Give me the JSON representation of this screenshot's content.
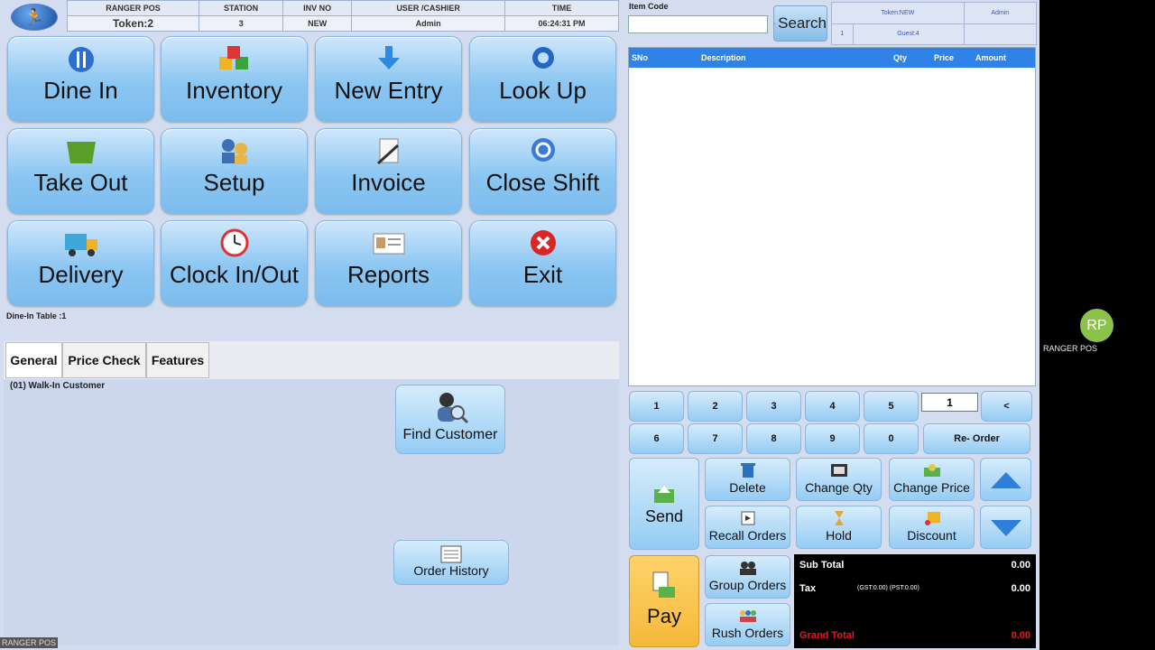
{
  "header": {
    "columns": [
      "RANGER POS",
      "STATION",
      "INV NO",
      "USER /CASHIER",
      "TIME"
    ],
    "values": [
      "Token:2",
      "3",
      "NEW",
      "Admin",
      "06:24:31 PM"
    ]
  },
  "tiles": [
    {
      "label": "Dine In",
      "icon": "dine-in-icon"
    },
    {
      "label": "Inventory",
      "icon": "inventory-cubes-icon"
    },
    {
      "label": "New Entry",
      "icon": "download-arrow-icon"
    },
    {
      "label": "Look Up",
      "icon": "magnifier-icon"
    },
    {
      "label": "Take Out",
      "icon": "takeout-bag-icon"
    },
    {
      "label": "Setup",
      "icon": "users-setup-icon"
    },
    {
      "label": "Invoice",
      "icon": "invoice-pen-icon"
    },
    {
      "label": "Close Shift",
      "icon": "refresh-icon"
    },
    {
      "label": "Delivery",
      "icon": "delivery-truck-icon"
    },
    {
      "label": "Clock In/Out",
      "icon": "clock-icon"
    },
    {
      "label": "Reports",
      "icon": "report-card-icon"
    },
    {
      "label": "Exit",
      "icon": "exit-x-icon"
    }
  ],
  "dine_in_table": "Dine-In Table :1",
  "tabs": [
    "General",
    "Price Check",
    "Features"
  ],
  "customer": "(01) Walk-In Customer",
  "find_customer": "Find Customer",
  "order_history": "Order History",
  "item_code": {
    "label": "Item Code",
    "value": ""
  },
  "search_label": "Search",
  "info": {
    "token": "Token:NEW",
    "user": "Admin",
    "table": "1",
    "guest": "Guest:4"
  },
  "grid_headers": [
    "SNo",
    "Description",
    "Qty",
    "Price",
    "Amount"
  ],
  "keypad": [
    "1",
    "2",
    "3",
    "4",
    "5",
    "6",
    "7",
    "8",
    "9",
    "0"
  ],
  "qty_value": "1",
  "backspace": "<",
  "reorder": "Re- Order",
  "actions": {
    "send": "Send",
    "delete": "Delete",
    "change_qty": "Change Qty",
    "change_price": "Change Price",
    "recall_orders": "Recall Orders",
    "hold": "Hold",
    "discount": "Discount",
    "pay": "Pay",
    "group_orders": "Group Orders",
    "rush_orders": "Rush Orders"
  },
  "totals": {
    "sub_total_label": "Sub Total",
    "sub_total": "0.00",
    "tax_label": "Tax",
    "tax_detail": "(GST:0.00) (PST:0.00)",
    "tax": "0.00",
    "grand_total_label": "Grand Total",
    "grand_total": "0.00"
  },
  "sidebar": {
    "avatar": "RP",
    "name": "RANGER POS"
  },
  "footer": "RANGER POS",
  "colors": {
    "accent": "#2f82e8",
    "pay": "#f5b93a",
    "grand_total": "#e31b1b"
  }
}
